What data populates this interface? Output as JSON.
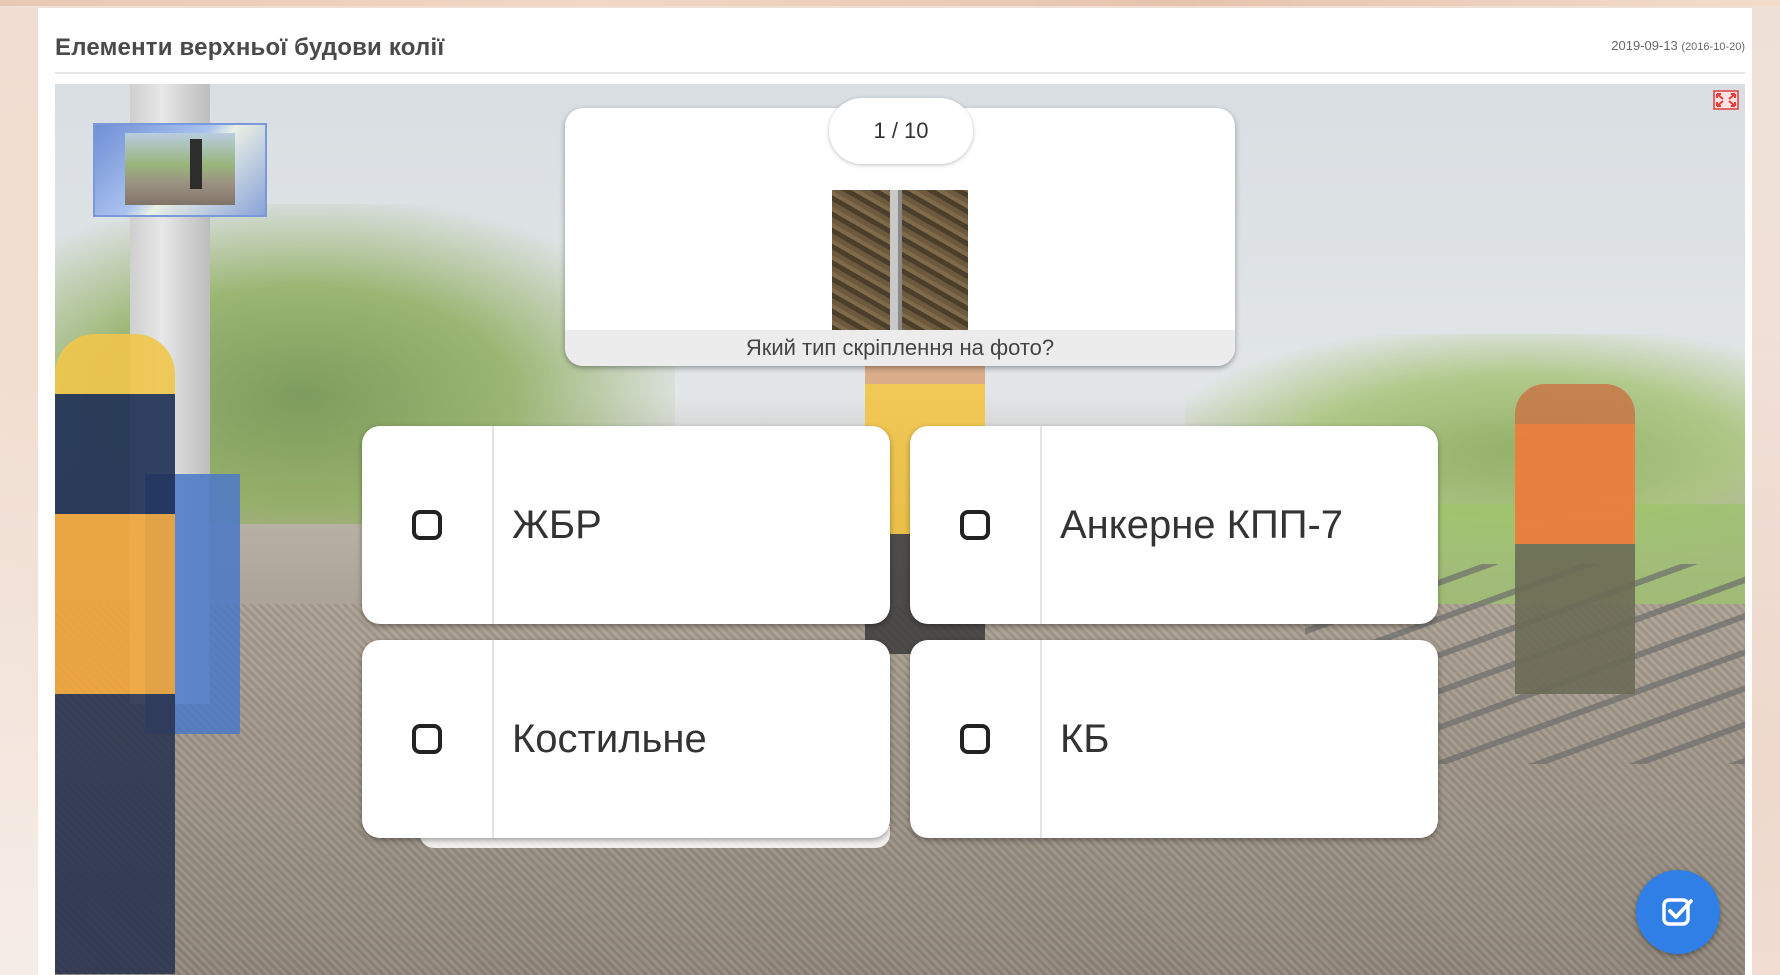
{
  "header": {
    "title": "Елементи верхньої будови колії",
    "date": "2019-09-13",
    "date_secondary": "(2016-10-20)"
  },
  "quiz": {
    "counter": "1 / 10",
    "question": "Який тип скріплення на фото?",
    "answers": [
      {
        "label": "ЖБР"
      },
      {
        "label": "Анкерне КПП-7"
      },
      {
        "label": "Костильне"
      },
      {
        "label": "КБ"
      }
    ]
  },
  "icons": {
    "fullscreen": "fullscreen-toggle-icon",
    "submit": "check-square-icon",
    "checkbox": "checkbox-empty-icon"
  },
  "colors": {
    "accent": "#2f7fe6",
    "fullscreen_icon": "#e23b3b",
    "title_text": "#4a4a4a"
  }
}
